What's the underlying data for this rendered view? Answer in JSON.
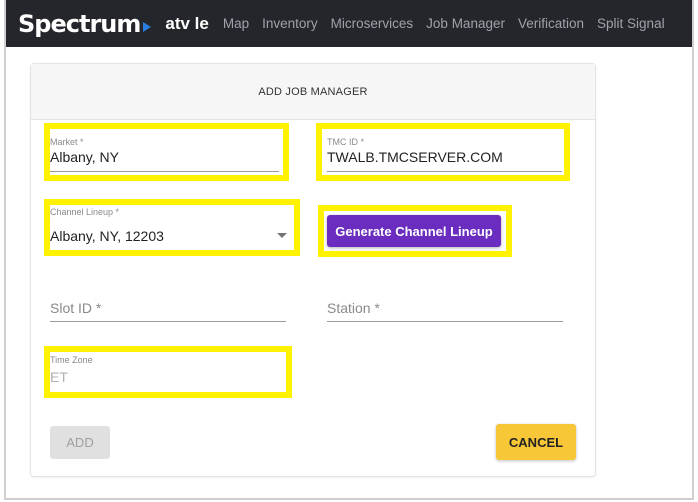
{
  "navbar": {
    "logo": "Spectrum",
    "app_name": "atv le",
    "links": [
      "Map",
      "Inventory",
      "Microservices",
      "Job Manager",
      "Verification",
      "Split Signal"
    ]
  },
  "form": {
    "title": "ADD JOB MANAGER",
    "market": {
      "label": "Market *",
      "value": "Albany, NY"
    },
    "tmc_id": {
      "label": "TMC ID *",
      "value": "TWALB.TMCSERVER.COM"
    },
    "channel_lineup": {
      "label": "Channel Lineup *",
      "value": "Albany, NY, 12203"
    },
    "generate_button": "Generate Channel Lineup",
    "slot_id": {
      "placeholder": "Slot ID *"
    },
    "station": {
      "placeholder": "Station *"
    },
    "time_zone": {
      "label": "Time Zone",
      "value": "ET"
    },
    "add_button": "ADD",
    "cancel_button": "CANCEL"
  },
  "colors": {
    "navbar_bg": "#24262b",
    "highlight": "#fff200",
    "generate_button": "#6a2dbf",
    "cancel_button": "#f7c738",
    "brand_arrow": "#2a7de1"
  }
}
